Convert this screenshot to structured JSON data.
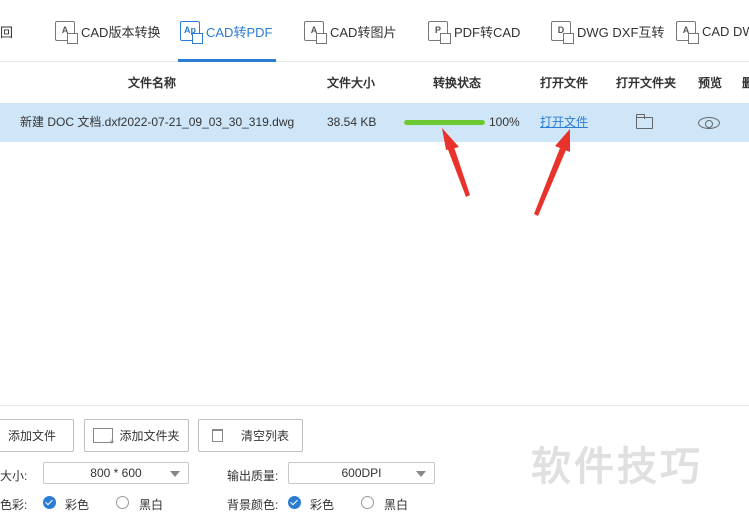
{
  "nav": {
    "back_label": "回",
    "tabs": [
      {
        "label": "CAD版本转换",
        "icon_text": "A",
        "icon": "cad-version-icon"
      },
      {
        "label": "CAD转PDF",
        "icon_text": "Ap",
        "icon": "cad-to-pdf-icon",
        "active": true
      },
      {
        "label": "CAD转图片",
        "icon_text": "A",
        "icon": "cad-to-image-icon"
      },
      {
        "label": "PDF转CAD",
        "icon_text": "P",
        "icon": "pdf-to-cad-icon"
      },
      {
        "label": "DWG DXF互转",
        "icon_text": "D",
        "icon": "dwg-dxf-icon"
      },
      {
        "label": "CAD DWF",
        "icon_text": "A",
        "icon": "cad-dwf-icon"
      }
    ]
  },
  "table": {
    "headers": {
      "name": "文件名称",
      "size": "文件大小",
      "status": "转换状态",
      "open_file": "打开文件",
      "open_folder": "打开文件夹",
      "preview": "预览",
      "delete": "删"
    },
    "rows": [
      {
        "name": "新建 DOC 文档.dxf2022-07-21_09_03_30_319.dwg",
        "size": "38.54 KB",
        "progress": 100,
        "progress_text": "100%",
        "open_link": "打开文件"
      }
    ]
  },
  "bottom": {
    "add_file": "添加文件",
    "add_folder": "添加文件夹",
    "clear_list": "清空列表",
    "size_label": "大小:",
    "size_value": "800 * 600",
    "quality_label": "输出质量:",
    "quality_value": "600DPI",
    "color_label": "色彩:",
    "color_option_color": "彩色",
    "color_option_bw": "黑白",
    "bg_label": "背景颜色:",
    "bg_option_color": "彩色",
    "bg_option_bw": "黑白"
  },
  "watermark": "软件技巧",
  "colors": {
    "accent": "#2b7cd3",
    "row_selected": "#cfe6f8",
    "progress": "#6cc831",
    "arrow": "#e8322c"
  }
}
